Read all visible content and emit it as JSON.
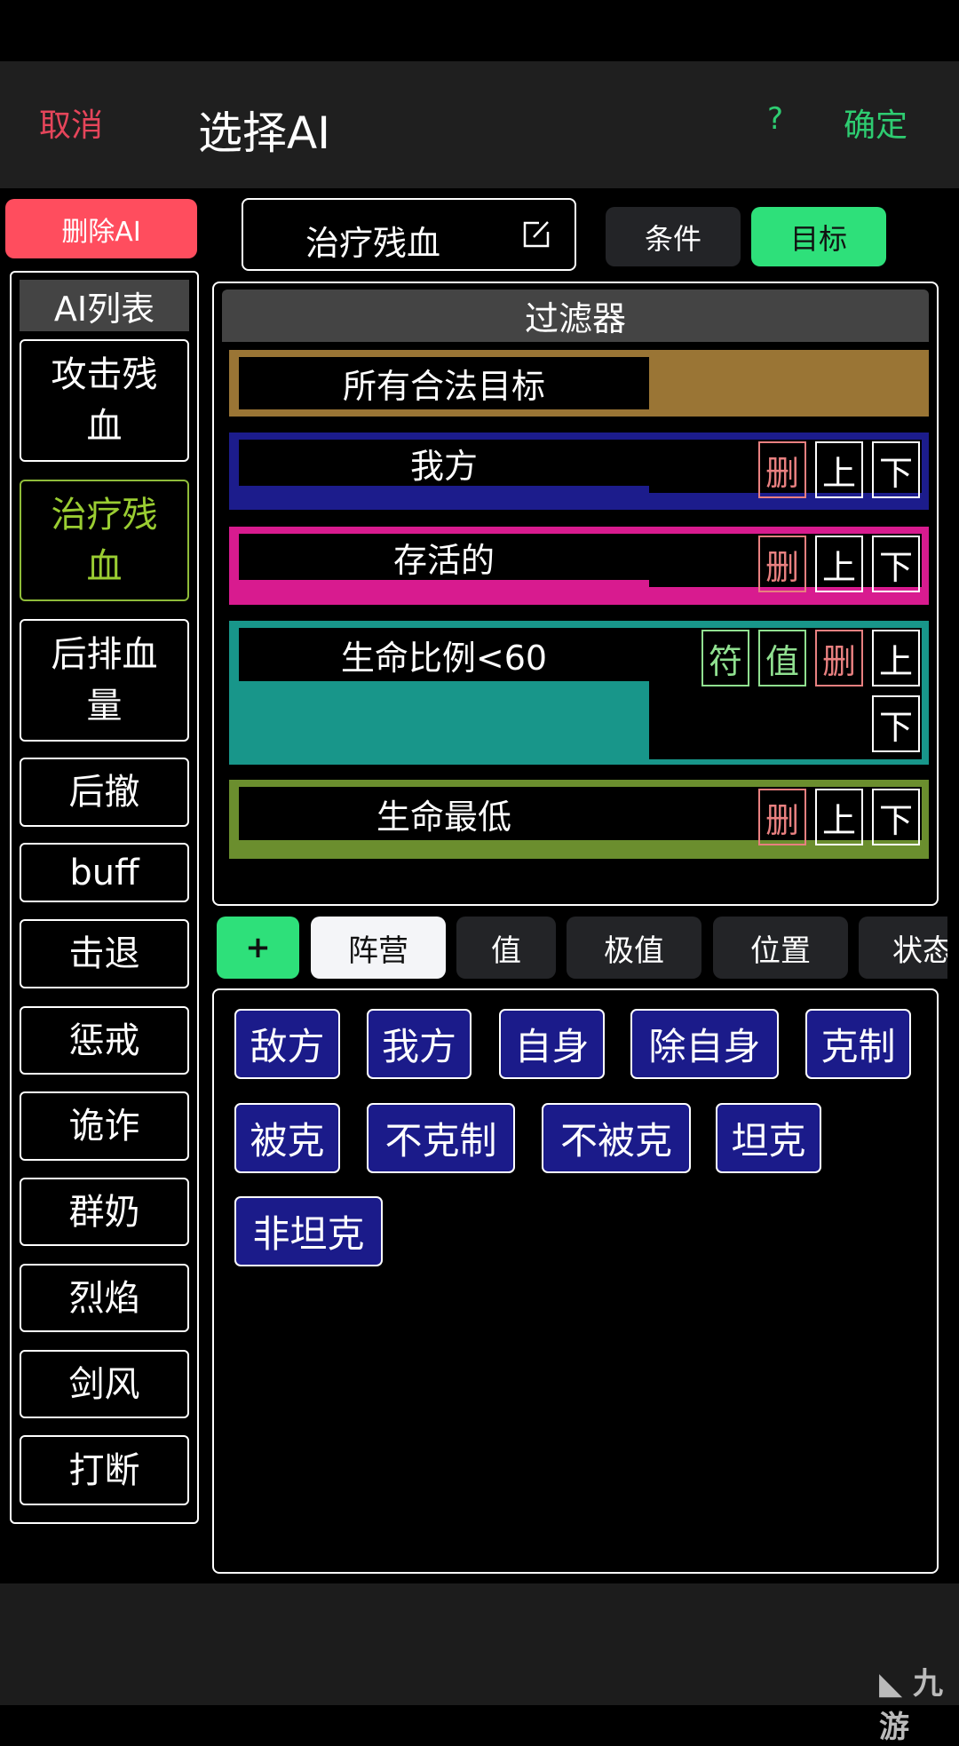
{
  "header": {
    "cancel": "取消",
    "title": "选择AI",
    "help": "?",
    "confirm": "确定"
  },
  "toolbar": {
    "delete_ai": "删除AI",
    "ai_name": "治疗残血",
    "tab_condition": "条件",
    "tab_target": "目标"
  },
  "sidebar": {
    "title": "AI列表",
    "items": [
      {
        "label": "攻击残血",
        "selected": false
      },
      {
        "label": "治疗残血",
        "selected": true
      },
      {
        "label": "后排血量",
        "selected": false
      },
      {
        "label": "后撤",
        "selected": false
      },
      {
        "label": "buff",
        "selected": false
      },
      {
        "label": "击退",
        "selected": false
      },
      {
        "label": "惩戒",
        "selected": false
      },
      {
        "label": "诡诈",
        "selected": false
      },
      {
        "label": "群奶",
        "selected": false
      },
      {
        "label": "烈焰",
        "selected": false
      },
      {
        "label": "剑风",
        "selected": false
      },
      {
        "label": "打断",
        "selected": false
      }
    ]
  },
  "filter": {
    "title": "过滤器",
    "buttons": {
      "symbol": "符",
      "value": "值",
      "delete": "删",
      "up": "上",
      "down": "下"
    },
    "rows": [
      {
        "label": "所有合法目标",
        "color": "#9a7535"
      },
      {
        "label": "我方",
        "color": "#1c1c8c"
      },
      {
        "label": "存活的",
        "color": "#d81b8f"
      },
      {
        "label": "生命比例<60",
        "color": "#18968a"
      },
      {
        "label": "生命最低",
        "color": "#6b8e2e"
      }
    ]
  },
  "category_tabs": {
    "add": "+",
    "tabs": [
      "阵营",
      "值",
      "极值",
      "位置",
      "状态"
    ],
    "active": "阵营"
  },
  "options": [
    "敌方",
    "我方",
    "自身",
    "除自身",
    "克制",
    "被克",
    "不克制",
    "不被克",
    "坦克",
    "非坦克"
  ],
  "watermark": "九游",
  "colors": {
    "accent_green": "#2ee07a",
    "danger": "#ff4d5e",
    "chip_bg": "#1b1b8a"
  }
}
